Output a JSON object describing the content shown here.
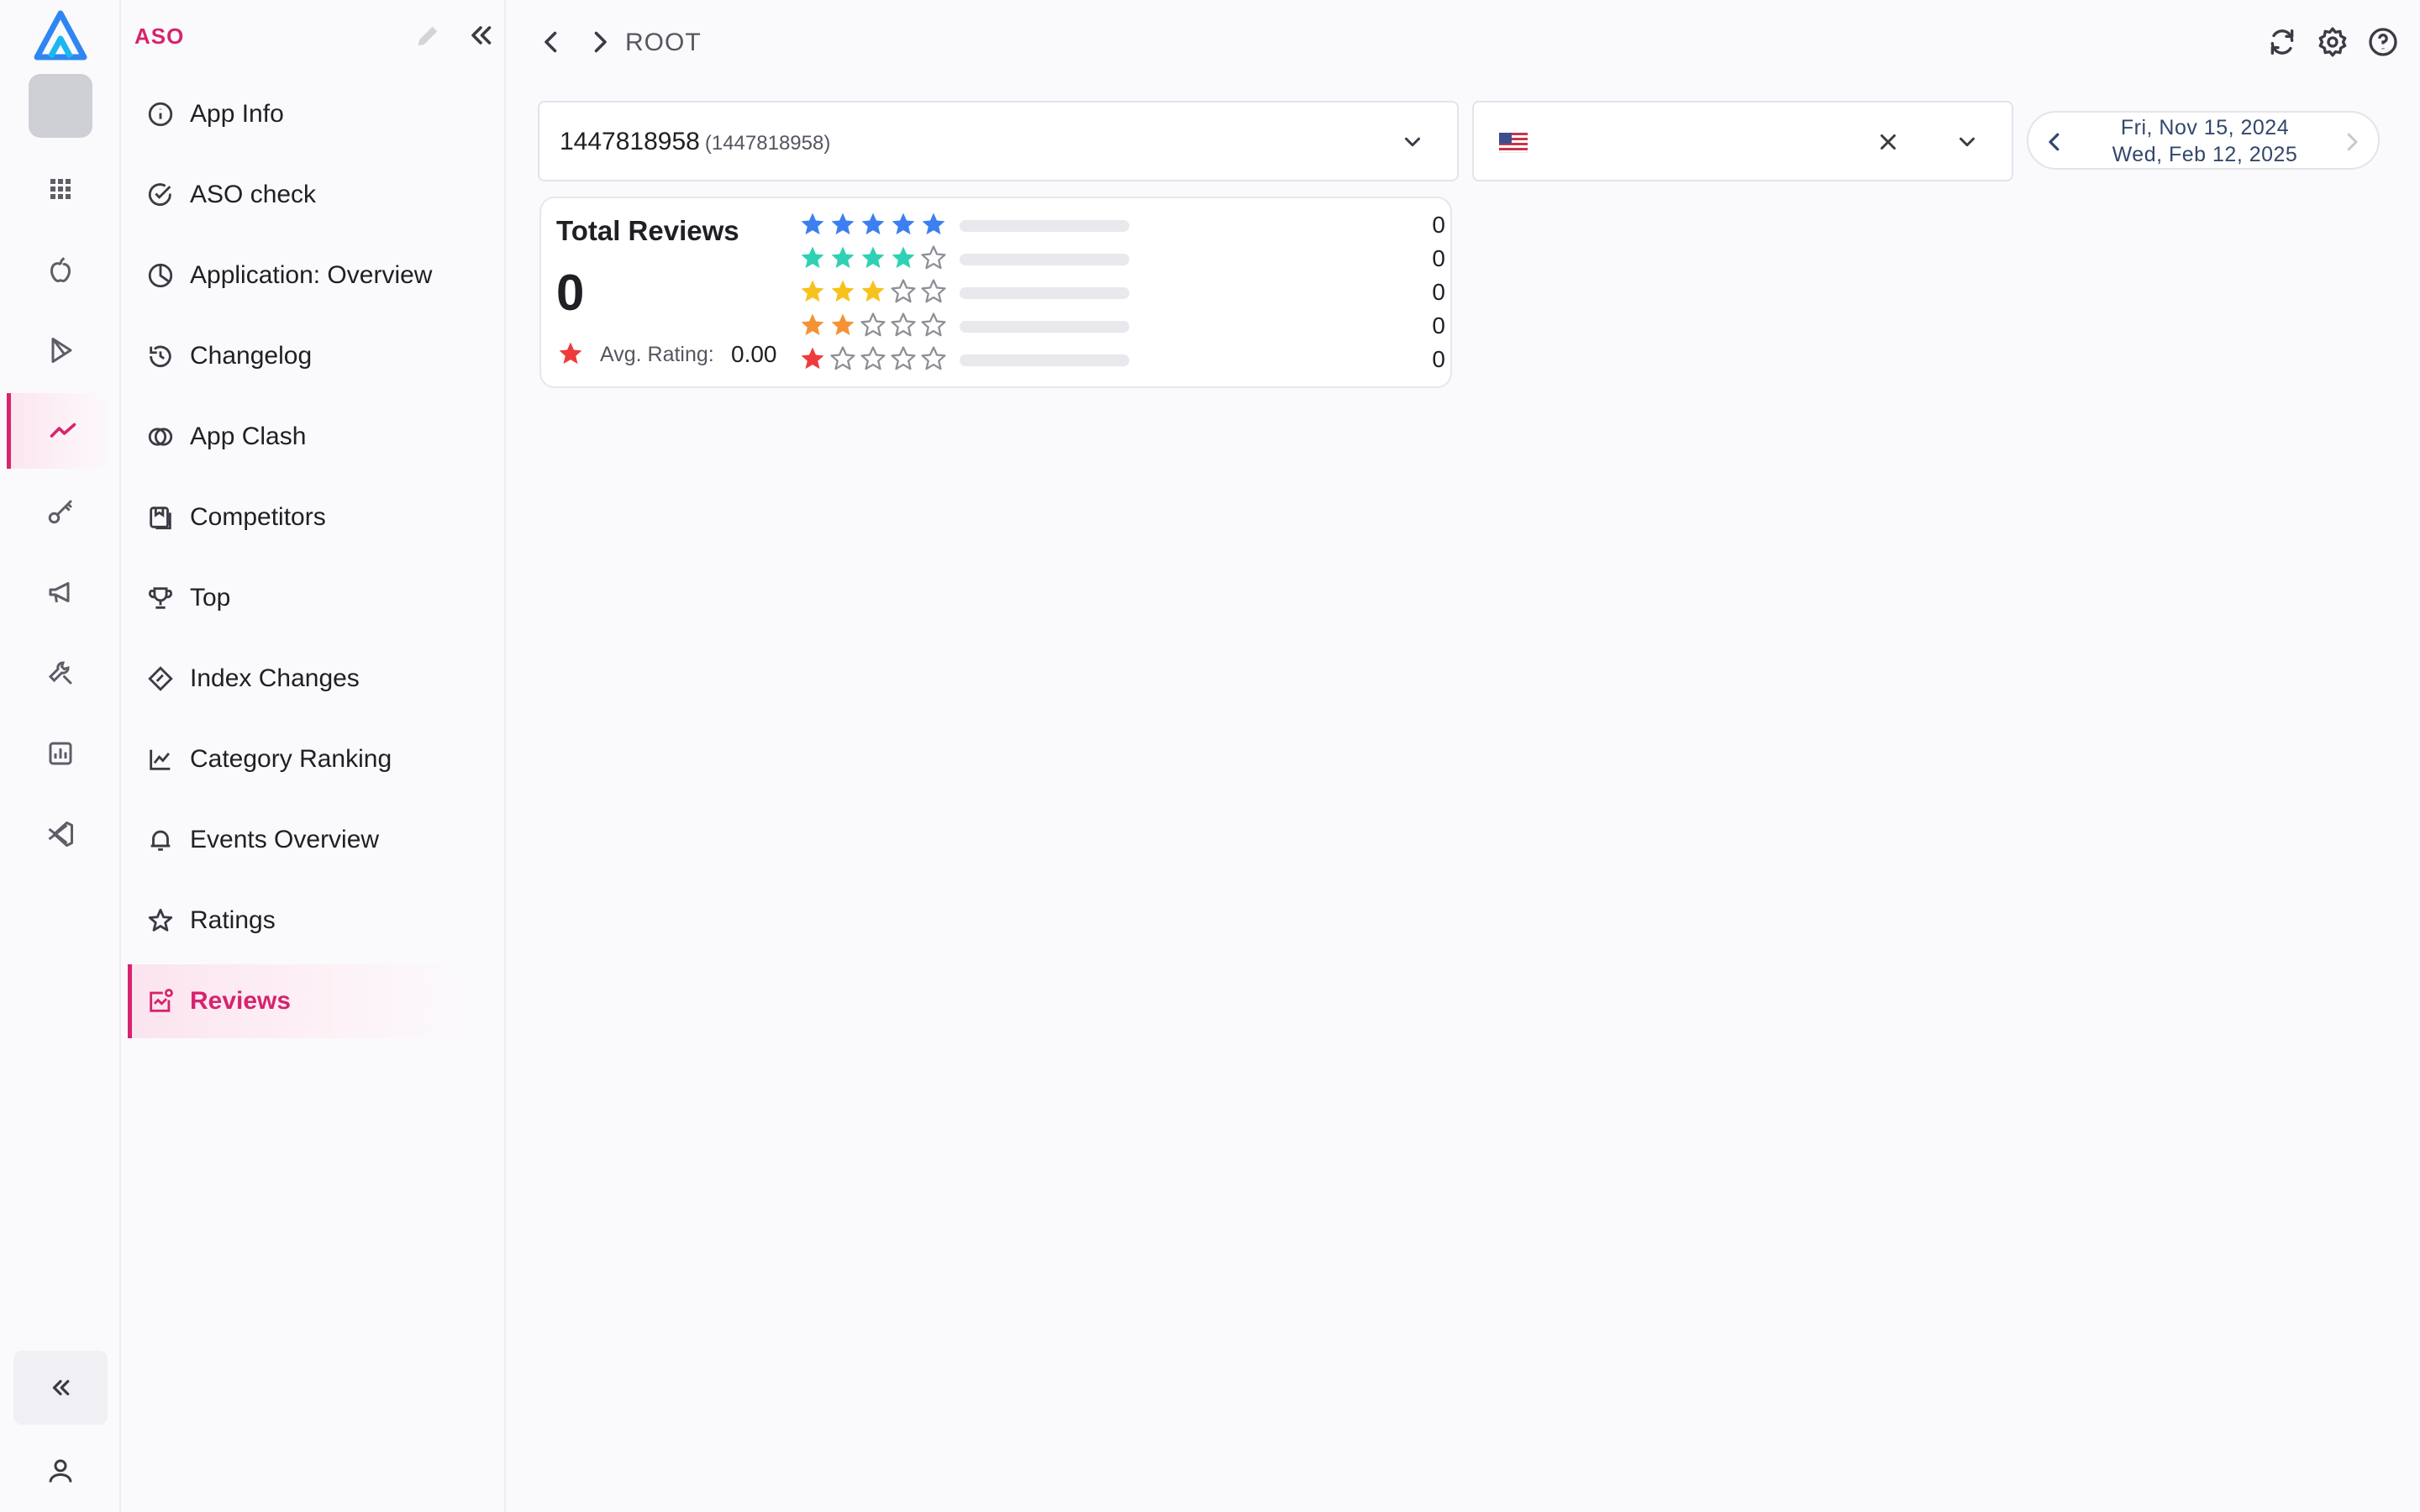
{
  "sidebar": {
    "title": "ASO",
    "items": [
      {
        "label": "App Info"
      },
      {
        "label": "ASO check"
      },
      {
        "label": "Application: Overview"
      },
      {
        "label": "Changelog"
      },
      {
        "label": "App Clash"
      },
      {
        "label": "Competitors"
      },
      {
        "label": "Top"
      },
      {
        "label": "Index Changes"
      },
      {
        "label": "Category Ranking"
      },
      {
        "label": "Events Overview"
      },
      {
        "label": "Ratings"
      },
      {
        "label": "Reviews"
      }
    ],
    "active": "Reviews"
  },
  "header": {
    "breadcrumb": "ROOT"
  },
  "filters": {
    "app_value": "1447818958",
    "app_id": "(1447818958)",
    "country_flag": "us-flag-icon",
    "date_start": "Fri, Nov 15, 2024",
    "date_end": "Wed, Feb 12, 2025"
  },
  "reviews": {
    "title": "Total Reviews",
    "total": "0",
    "avg_label": "Avg. Rating:",
    "avg_value": "0.00",
    "rows": [
      {
        "stars": 5,
        "count": "0",
        "color": "#3b7ff0"
      },
      {
        "stars": 4,
        "count": "0",
        "color": "#2fd1b4"
      },
      {
        "stars": 3,
        "count": "0",
        "color": "#f7c21b"
      },
      {
        "stars": 2,
        "count": "0",
        "color": "#f59234"
      },
      {
        "stars": 1,
        "count": "0",
        "color": "#ee3b3b"
      }
    ]
  },
  "colors": {
    "accent": "#d6246e",
    "logo": "#2f86f2"
  }
}
